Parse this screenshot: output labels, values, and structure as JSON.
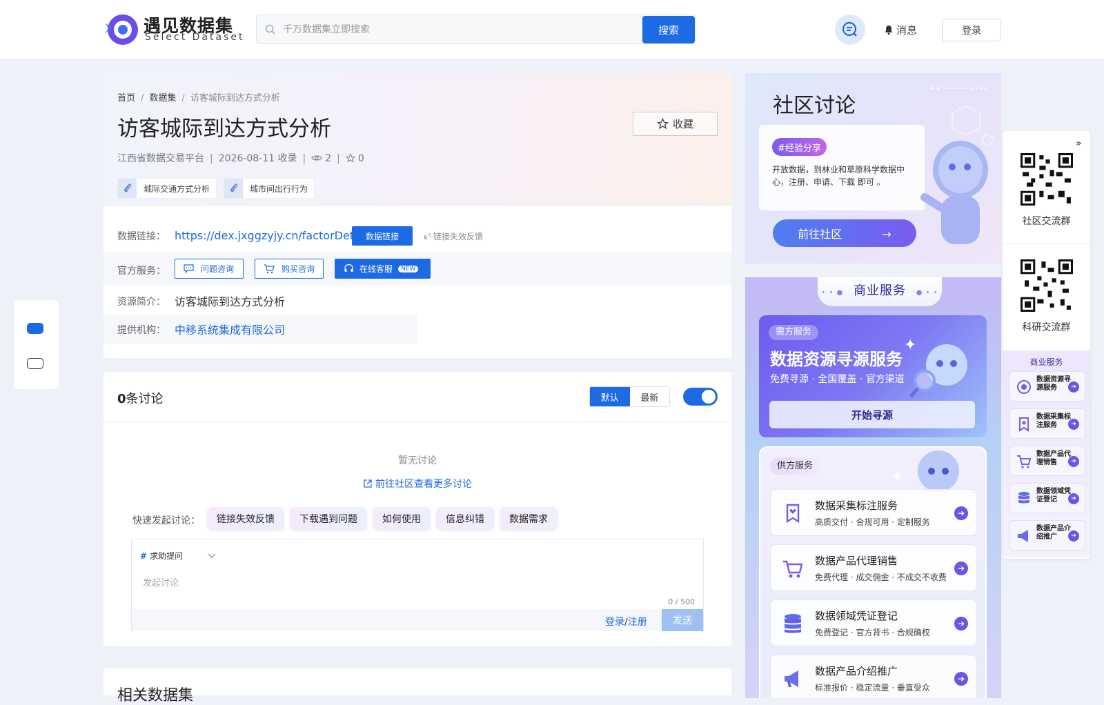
{
  "header": {
    "logo_title": "遇见数据集",
    "logo_subtitle": "Select Dataset",
    "search_placeholder": "千万数据集立即搜索",
    "search_button": "搜索",
    "messages_label": "消息",
    "login_label": "登录"
  },
  "breadcrumb": {
    "home": "首页",
    "datasets": "数据集",
    "current": "访客城际到达方式分析"
  },
  "dataset": {
    "title": "访客城际到达方式分析",
    "favorite_label": "收藏",
    "source": "江西省数据交易平台",
    "date_collected": "2026-08-11 收录",
    "views": "2",
    "favorites": "0",
    "tags": [
      "城际交通方式分析",
      "城市间出行行为"
    ],
    "data_link_label": "数据链接：",
    "data_link_url": "https://dex.jxggzyjy.cn/factorDetail",
    "data_link_button": "数据链接",
    "link_feedback": "链接失效反馈",
    "service_label": "官方服务：",
    "services": [
      "问题咨询",
      "购买咨询",
      "在线客服"
    ],
    "new_badge": "NEW",
    "intro_label": "资源简介：",
    "intro": "访客城际到达方式分析",
    "org_label": "提供机构：",
    "org": "中移系统集成有限公司"
  },
  "discussion": {
    "count": "0",
    "count_suffix": "条讨论",
    "sort_default": "默认",
    "sort_latest": "最新",
    "empty_text": "暂无讨论",
    "goto_community": "前往社区查看更多讨论",
    "quick_label": "快速发起讨论：",
    "quick_chips": [
      "链接失效反馈",
      "下载遇到问题",
      "如何使用",
      "信息纠错",
      "数据需求"
    ],
    "topic_hash": "#",
    "topic_select": "求助提问",
    "placeholder": "发起讨论",
    "char_count": "0 / 500",
    "login": "登录",
    "slash": "/",
    "register": "注册",
    "send": "发送"
  },
  "related": {
    "title": "相关数据集"
  },
  "community": {
    "title": "社区讨论",
    "badge": "#经验分享",
    "desc": "开放数据，到林业和草原科学数据中心，注册、申请、下载 即可 。",
    "button": "前往社区"
  },
  "business": {
    "title": "商业服务",
    "demand_badge": "需方服务",
    "demand_title": "数据资源寻源服务",
    "demand_sub": "免费寻源 · 全国覆盖 · 官方渠道",
    "demand_button": "开始寻源",
    "supply_badge": "供方服务",
    "supply_items": [
      {
        "title": "数据采集标注服务",
        "sub": "高质交付 · 合规可用 · 定制服务"
      },
      {
        "title": "数据产品代理销售",
        "sub": "免费代理 · 成交佣金 · 不成交不收费"
      },
      {
        "title": "数据领域凭证登记",
        "sub": "免费登记 · 官方背书 · 合规确权"
      },
      {
        "title": "数据产品介绍推广",
        "sub": "标准报价 · 稳定流量 · 垂直受众"
      }
    ]
  },
  "right_panel": {
    "qr1_label": "社区交流群",
    "qr2_label": "科研交流群",
    "biz_title": "商业服务",
    "items": [
      {
        "label": "数据资源寻源服务",
        "icon": "target-icon"
      },
      {
        "label": "数据采集标注服务",
        "icon": "bookmark-icon"
      },
      {
        "label": "数据产品代理销售",
        "icon": "cart-icon"
      },
      {
        "label": "数据领域凭证登记",
        "icon": "database-icon"
      },
      {
        "label": "数据产品介绍推广",
        "icon": "megaphone-icon"
      }
    ]
  },
  "colors": {
    "primary": "#1d6ae5",
    "accent_purple": "#6b54e8"
  }
}
